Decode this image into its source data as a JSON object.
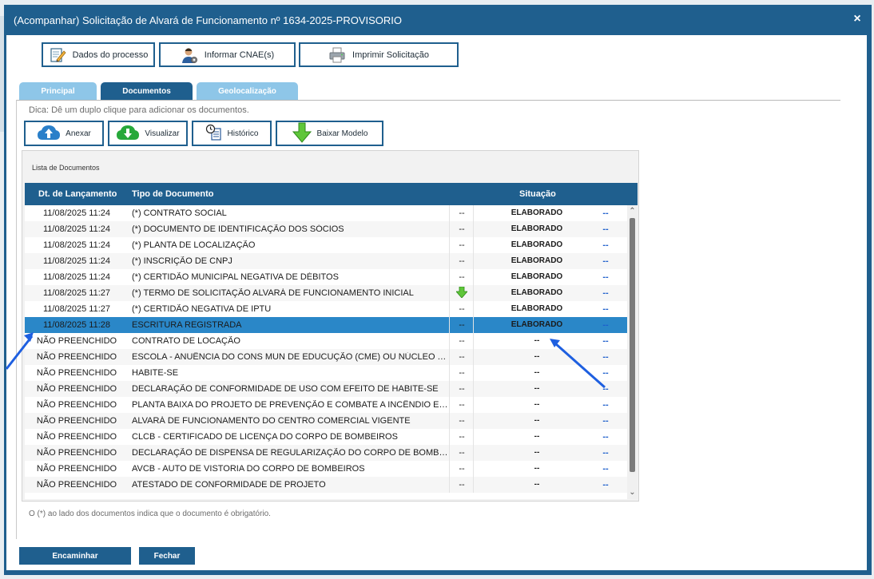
{
  "modal": {
    "title": "(Acompanhar) Solicitação de Alvará de Funcionamento nº 1634-2025-PROVISORIO",
    "close": "×"
  },
  "toolbar": {
    "dados": "Dados do processo",
    "cnae": "Informar CNAE(s)",
    "imprimir": "Imprimir Solicitação"
  },
  "tabs": [
    {
      "label": "Principal"
    },
    {
      "label": "Documentos"
    },
    {
      "label": "Geolocalização"
    }
  ],
  "hint": "Dica: Dê um duplo clique para adicionar os documentos.",
  "doc_toolbar": {
    "anexar": "Anexar",
    "visualizar": "Visualizar",
    "historico": "Histórico",
    "baixar": "Baixar Modelo"
  },
  "list": {
    "title": "Lista de Documentos",
    "headers": {
      "date": "Dt. de Lançamento",
      "type": "Tipo de Documento",
      "status": "Situação"
    },
    "rows": [
      {
        "date": "11/08/2025 11:24",
        "type": "(*) CONTRATO SOCIAL",
        "c3": "--",
        "status": "ELABORADO",
        "c5": "--"
      },
      {
        "date": "11/08/2025 11:24",
        "type": "(*) DOCUMENTO DE IDENTIFICAÇÃO DOS SÓCIOS",
        "c3": "--",
        "status": "ELABORADO",
        "c5": "--"
      },
      {
        "date": "11/08/2025 11:24",
        "type": "(*) PLANTA DE LOCALIZAÇÃO",
        "c3": "--",
        "status": "ELABORADO",
        "c5": "--"
      },
      {
        "date": "11/08/2025 11:24",
        "type": "(*) INSCRIÇÃO DE CNPJ",
        "c3": "--",
        "status": "ELABORADO",
        "c5": "--"
      },
      {
        "date": "11/08/2025 11:24",
        "type": "(*) CERTIDÃO MUNICIPAL NEGATIVA DE DÉBITOS",
        "c3": "--",
        "status": "ELABORADO",
        "c5": "--"
      },
      {
        "date": "11/08/2025 11:27",
        "type": "(*) TERMO DE SOLICITAÇÃO ALVARÁ DE FUNCIONAMENTO INICIAL",
        "c3": "",
        "status": "ELABORADO",
        "c5": "--"
      },
      {
        "date": "11/08/2025 11:27",
        "type": "(*) CERTIDÃO NEGATIVA DE IPTU",
        "c3": "--",
        "status": "ELABORADO",
        "c5": "--"
      },
      {
        "date": "11/08/2025 11:28",
        "type": "ESCRITURA REGISTRADA",
        "c3": "--",
        "status": "ELABORADO",
        "c5": "--"
      },
      {
        "date": "NÃO PREENCHIDO",
        "type": "CONTRATO DE LOCAÇÃO",
        "c3": "--",
        "status": "--",
        "c5": "--"
      },
      {
        "date": "NÃO PREENCHIDO",
        "type": "ESCOLA - ANUÊNCIA DO CONS MUN DE EDUCUÇÃO (CME) OU NÚCLEO TERRITORIAL",
        "c3": "--",
        "status": "--",
        "c5": "--"
      },
      {
        "date": "NÃO PREENCHIDO",
        "type": "HABITE-SE",
        "c3": "--",
        "status": "--",
        "c5": "--"
      },
      {
        "date": "NÃO PREENCHIDO",
        "type": "DECLARAÇÃO DE CONFORMIDADE DE USO COM EFEITO DE HABITE-SE",
        "c3": "--",
        "status": "--",
        "c5": "--"
      },
      {
        "date": "NÃO PREENCHIDO",
        "type": "PLANTA BAIXA DO PROJETO DE PREVENÇÃO E COMBATE A INCÊNDIO E PÂNICO",
        "c3": "--",
        "status": "--",
        "c5": "--"
      },
      {
        "date": "NÃO PREENCHIDO",
        "type": "ALVARÁ DE FUNCIONAMENTO DO CENTRO COMERCIAL VIGENTE",
        "c3": "--",
        "status": "--",
        "c5": "--"
      },
      {
        "date": "NÃO PREENCHIDO",
        "type": "CLCB - CERTIFICADO DE LICENÇA DO CORPO DE BOMBEIROS",
        "c3": "--",
        "status": "--",
        "c5": "--"
      },
      {
        "date": "NÃO PREENCHIDO",
        "type": "DECLARAÇÃO DE DISPENSA DE REGULARIZAÇÃO DO CORPO DE BOMBEIROS",
        "c3": "--",
        "status": "--",
        "c5": "--"
      },
      {
        "date": "NÃO PREENCHIDO",
        "type": "AVCB - AUTO DE VISTORIA DO CORPO DE BOMBEIROS",
        "c3": "--",
        "status": "--",
        "c5": "--"
      },
      {
        "date": "NÃO PREENCHIDO",
        "type": "ATESTADO DE CONFORMIDADE DE PROJETO",
        "c3": "--",
        "status": "--",
        "c5": "--"
      }
    ]
  },
  "legend_note": "O (*) ao lado dos documentos indica que o documento é obrigatório.",
  "footer": {
    "encaminhar": "Encaminhar",
    "fechar": "Fechar"
  },
  "colors": {
    "primary": "#1f5f8e",
    "tab_inactive": "#8ec6e8",
    "selected_row": "#2a87c8",
    "annotation_arrow": "#1e5fe0"
  }
}
